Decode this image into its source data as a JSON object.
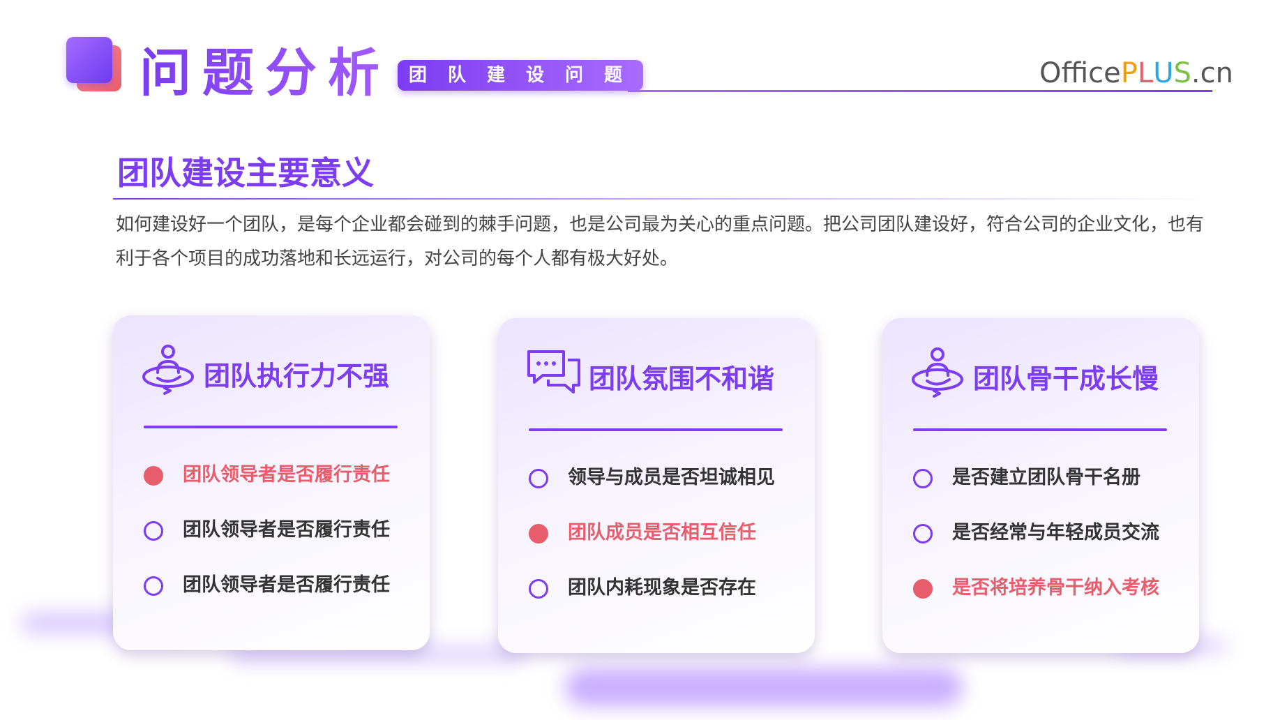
{
  "header": {
    "title": "问题分析",
    "subtitle": "团队建设问题",
    "brand": {
      "prefix": "Office",
      "p": "P",
      "l": "L",
      "u": "U",
      "s": "S",
      "suffix": ".cn"
    }
  },
  "section": {
    "title": "团队建设主要意义",
    "intro": "如何建设好一个团队，是每个企业都会碰到的棘手问题，也是公司最为关心的重点问题。把公司团队建设好，符合公司的企业文化，也有利于各个项目的成功落地和长远运行，对公司的每个人都有极大好处。"
  },
  "cards": [
    {
      "icon": "person-orbit-icon",
      "title": "团队执行力不强",
      "items": [
        {
          "text": "团队领导者是否履行责任",
          "highlighted": true
        },
        {
          "text": "团队领导者是否履行责任",
          "highlighted": false
        },
        {
          "text": "团队领导者是否履行责任",
          "highlighted": false
        }
      ]
    },
    {
      "icon": "chat-bubbles-icon",
      "title": "团队氛围不和谐",
      "items": [
        {
          "text": "领导与成员是否坦诚相见",
          "highlighted": false
        },
        {
          "text": "团队成员是否相互信任",
          "highlighted": true
        },
        {
          "text": "团队内耗现象是否存在",
          "highlighted": false
        }
      ]
    },
    {
      "icon": "person-orbit-icon",
      "title": "团队骨干成长慢",
      "items": [
        {
          "text": "是否建立团队骨干名册",
          "highlighted": false
        },
        {
          "text": "是否经常与年轻成员交流",
          "highlighted": false
        },
        {
          "text": "是否将培养骨干纳入考核",
          "highlighted": true
        }
      ]
    }
  ],
  "colors": {
    "accent": "#7b3cf2",
    "highlight": "#e85d6b",
    "brand_p": "#f2a000",
    "brand_l": "#e85d6b",
    "brand_u": "#2aa7e0",
    "brand_s": "#7ac143"
  }
}
